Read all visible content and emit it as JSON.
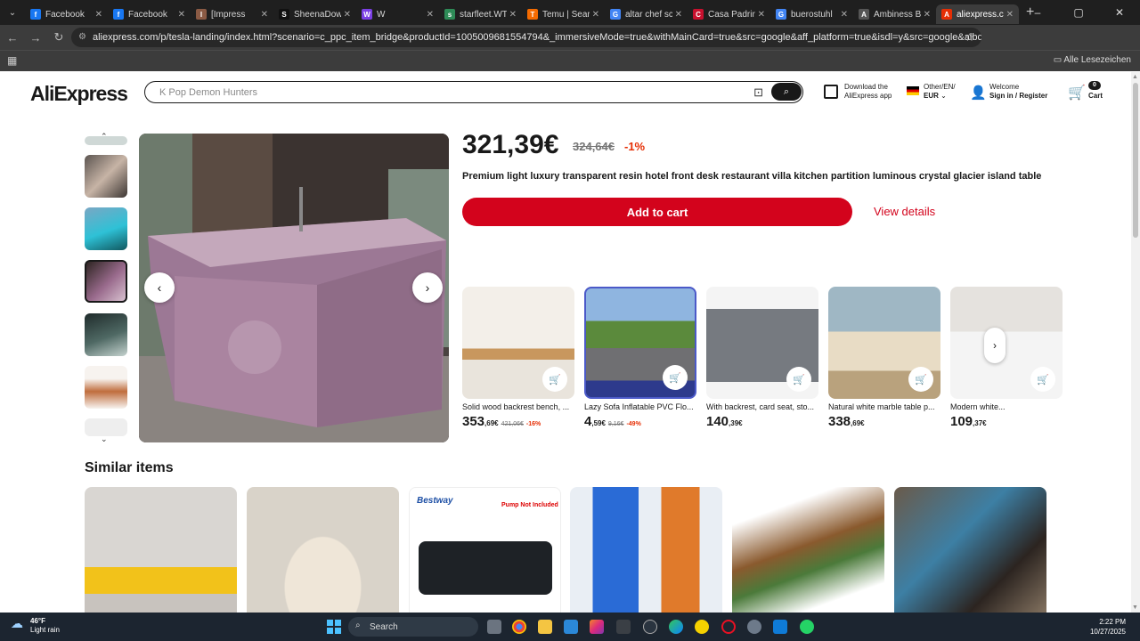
{
  "browser": {
    "tabs": [
      {
        "title": "Facebook",
        "icon": "facebook-icon",
        "color": "#1877f2",
        "glyph": "f"
      },
      {
        "title": "Facebook",
        "icon": "facebook-icon",
        "color": "#1877f2",
        "glyph": "f"
      },
      {
        "title": "[Impress",
        "icon": "page-icon",
        "color": "#8a5a44",
        "glyph": "I"
      },
      {
        "title": "SheenaDow",
        "icon": "tiktok-icon",
        "color": "#111111",
        "glyph": "S"
      },
      {
        "title": "W",
        "icon": "multi-icon",
        "color": "#7b3fe4",
        "glyph": "W"
      },
      {
        "title": "starfleet.WT",
        "icon": "leaf-icon",
        "color": "#2e8b57",
        "glyph": "s"
      },
      {
        "title": "Temu | Sear",
        "icon": "temu-icon",
        "color": "#f56b00",
        "glyph": "T"
      },
      {
        "title": "altar chef sc",
        "icon": "google-icon",
        "color": "#4285f4",
        "glyph": "G"
      },
      {
        "title": "Casa Padrin",
        "icon": "casa-icon",
        "color": "#c8102e",
        "glyph": "C"
      },
      {
        "title": "buerostuhl",
        "icon": "google-icon",
        "color": "#4285f4",
        "glyph": "G"
      },
      {
        "title": "Ambiness B",
        "icon": "page-icon",
        "color": "#555555",
        "glyph": "A"
      },
      {
        "title": "aliexpress.co",
        "icon": "aliexpress-icon",
        "color": "#e62e04",
        "glyph": "A",
        "active": true
      }
    ],
    "url": "aliexpress.com/p/tesla-landing/index.html?scenario=c_ppc_item_bridge&productId=1005009681554794&_immersiveMode=true&withMainCard=true&src=google&aff_platform=true&isdl=y&src=google&albch=shopping&acnt=272...",
    "bookmarks_all": "Alle Lesezeichen"
  },
  "header": {
    "logo": "AliExpress",
    "search_placeholder": "K Pop Demon Hunters",
    "download_line1": "Download the",
    "download_line2": "AliExpress app",
    "region_line1": "Other/EN/",
    "region_line2": "EUR",
    "welcome": "Welcome",
    "signin": "Sign in / Register",
    "cart_count": "0",
    "cart_label": "Cart"
  },
  "product": {
    "price": "321,39€",
    "old_price": "324,64€",
    "discount": "-1%",
    "title": "Premium light luxury transparent resin hotel front desk restaurant villa kitchen partition luminous crystal glacier island table",
    "add_to_cart": "Add to cart",
    "view_details": "View details"
  },
  "related": [
    {
      "title": "Solid wood backrest bench, ...",
      "price_int": "353",
      "price_dec": ",69€",
      "old": "421,06€",
      "off": "-16%"
    },
    {
      "title": "Lazy Sofa Inflatable PVC Flo...",
      "price_int": "4",
      "price_dec": ",59€",
      "old": "9,16€",
      "off": "-49%"
    },
    {
      "title": "With backrest, card seat, sto...",
      "price_int": "140",
      "price_dec": ",39€",
      "old": "",
      "off": ""
    },
    {
      "title": "Natural white marble table p...",
      "price_int": "338",
      "price_dec": ",69€",
      "old": "",
      "off": ""
    },
    {
      "title": "Modern white...",
      "price_int": "109",
      "price_dec": ",37€",
      "old": "",
      "off": ""
    }
  ],
  "similar": {
    "heading": "Similar items",
    "badge_brand": "Bestway",
    "badge_note": "Pump Not Included"
  },
  "taskbar": {
    "temp": "46°F",
    "condition": "Light rain",
    "search": "Search",
    "time": "2:22 PM",
    "date": "10/27/2025"
  }
}
